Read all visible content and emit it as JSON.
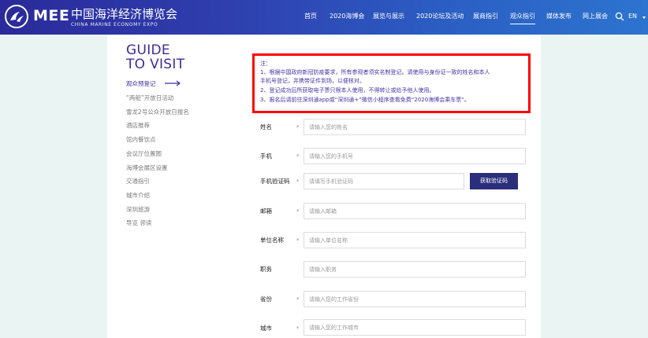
{
  "header": {
    "logo_text": "MEE",
    "brand_cn": "中国海洋经济博览会",
    "brand_en": "CHINA MARINE ECONOMY EXPO",
    "nav": [
      {
        "label": "首页"
      },
      {
        "label": "2020海博会"
      },
      {
        "label": "展览与展示"
      },
      {
        "label": "2020论坛及活动"
      },
      {
        "label": "展商指引"
      },
      {
        "label": "观众指引"
      },
      {
        "label": "媒体发布"
      },
      {
        "label": "网上展会"
      }
    ],
    "active_nav": "观众指引",
    "lang": "EN"
  },
  "sidebar": {
    "title_line1": "GUIDE",
    "title_line2": "TO VISIT",
    "items": [
      {
        "label": "观众预登记"
      },
      {
        "label": "“两船”开放日活动"
      },
      {
        "label": "雪龙2号公众开放日报名"
      },
      {
        "label": "酒店推荐"
      },
      {
        "label": "馆内餐饮点"
      },
      {
        "label": "会议厅位置图"
      },
      {
        "label": "海博会展区设置"
      },
      {
        "label": "交通指引"
      },
      {
        "label": "城市介绍"
      },
      {
        "label": "深圳旅游"
      },
      {
        "label": "导览 领读"
      }
    ]
  },
  "notice": {
    "lines": [
      "注：",
      "1、根据中国政府新冠防疫要求，所有参观者须实名制登记。请使用与身份证一致的姓名和本人",
      "手机号登记，并携带证件到场，以便核对。",
      "2、登记成功后所获取电子票只限本人使用，不得转让或给予他人使用。",
      "3、报名后请前往深圳通app或“深圳通+”微信小程序查看免费“2020海博会乘车票”。"
    ]
  },
  "form": {
    "required_mark": "*",
    "fields": [
      {
        "label": "姓名",
        "placeholder": "请输入您的姓名"
      },
      {
        "label": "手机",
        "placeholder": "请输入您的手机号"
      },
      {
        "label": "手机验证码",
        "placeholder": "请填写手机验证码"
      },
      {
        "label": "邮箱",
        "placeholder": "请输入邮箱"
      },
      {
        "label": "单位名称",
        "placeholder": "请输入单位名称"
      },
      {
        "label": "职务",
        "placeholder": "请输入职务"
      },
      {
        "label": "省份",
        "placeholder": "请输入您的工作省份"
      },
      {
        "label": "城市",
        "placeholder": "请输入您的工作城市"
      }
    ],
    "get_code_label": "获取验证码"
  },
  "colors": {
    "header_start": "#2a2a9a",
    "header_end": "#2c74cf",
    "accent": "#3f2b97",
    "notice_border": "#ff0000",
    "button_bg": "#2b2e7a",
    "side_panel": "#eaf4f2"
  }
}
